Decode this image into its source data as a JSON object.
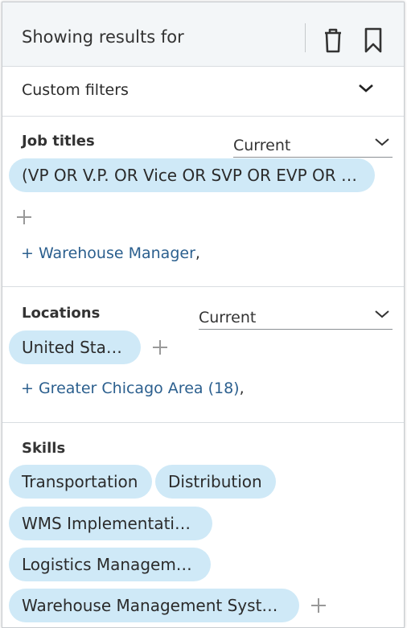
{
  "header": {
    "title": "Showing results for"
  },
  "custom_filters": {
    "label": "Custom filters"
  },
  "job_titles": {
    "title": "Job titles",
    "scope": "Current",
    "pill": "(VP OR V.P. OR Vice OR SVP OR EVP OR He…",
    "suggestion": "+ Warehouse Manager",
    "suggestion_sep": ","
  },
  "locations": {
    "title": "Locations",
    "scope": "Current",
    "pill": "United States",
    "suggestion": "+ Greater Chicago Area (18)",
    "suggestion_sep": ","
  },
  "skills": {
    "title": "Skills",
    "pills": [
      "Transportation",
      "Distribution",
      "WMS Implementations",
      "Logistics Management",
      "Warehouse Management Systems"
    ]
  },
  "colors": {
    "pill": "#cfe9f7",
    "link": "#2b5f8e",
    "header_bg": "#f3f6f8"
  },
  "icons": [
    "trash-icon",
    "bookmark-icon",
    "chevron-down-icon",
    "plus-icon"
  ]
}
